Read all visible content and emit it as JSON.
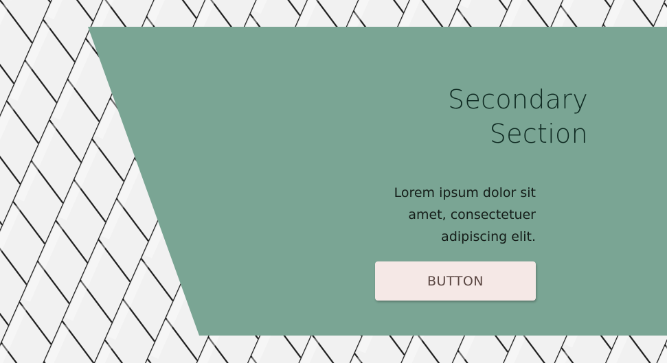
{
  "section": {
    "title": "Secondary\nSection",
    "body": "Lorem ipsum dolor sit amet, consectetuer adipiscing elit.",
    "button_label": "BUTTON"
  },
  "colors": {
    "panel": "#7aa594",
    "tile": "#f1f1f1",
    "tile_grout": "#1b1b1b",
    "button_bg": "#f5e8e6",
    "button_text": "#5a4642",
    "heading_text": "#0f2a22"
  },
  "background": {
    "pattern": "white-angled-tiles"
  }
}
